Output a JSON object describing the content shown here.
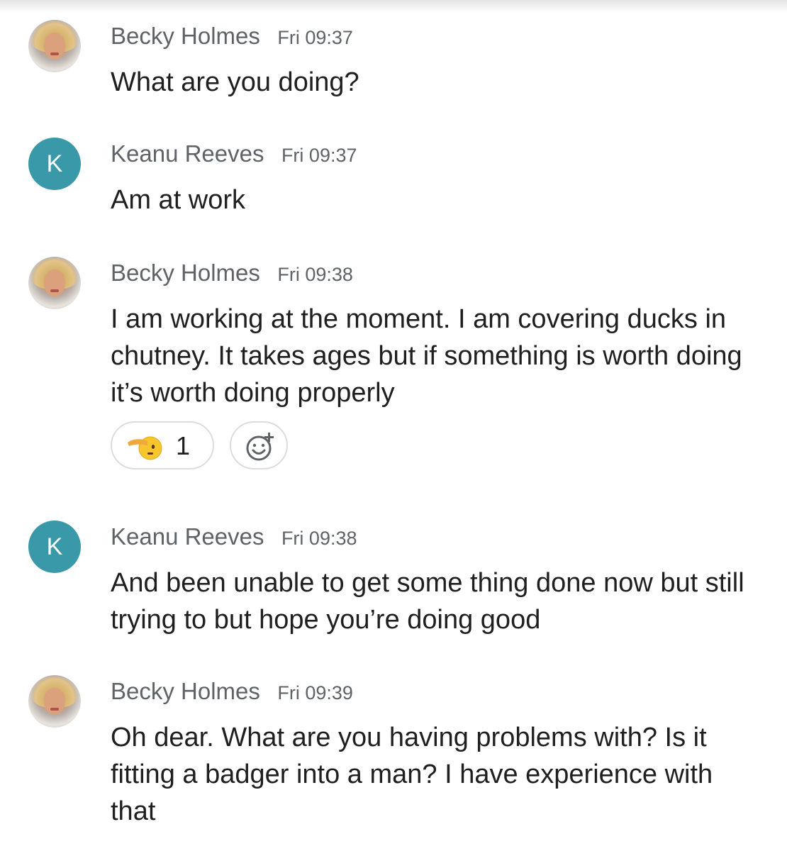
{
  "messages": [
    {
      "sender": "Becky Holmes",
      "time": "Fri 09:37",
      "avatar": "photo",
      "text": "What are you doing?"
    },
    {
      "sender": "Keanu Reeves",
      "time": "Fri 09:37",
      "avatar": "letter",
      "avatar_letter": "K",
      "avatar_color": "#3a99a8",
      "text": "Am at work"
    },
    {
      "sender": "Becky Holmes",
      "time": "Fri 09:38",
      "avatar": "photo",
      "text": "I am working at the moment. I am covering ducks in chutney. It takes ages but if something is worth doing it’s worth doing properly",
      "reactions": [
        {
          "emoji_icon": "saluting-face-icon",
          "count": "1"
        }
      ],
      "add_reaction_icon": "add-emoji-icon"
    },
    {
      "sender": "Keanu Reeves",
      "time": "Fri 09:38",
      "avatar": "letter",
      "avatar_letter": "K",
      "avatar_color": "#3a99a8",
      "text": "And been unable to get some thing done now but still trying to but hope you’re doing good"
    },
    {
      "sender": "Becky Holmes",
      "time": "Fri 09:39",
      "avatar": "photo",
      "text": "Oh dear. What are you having problems with? Is it fitting a badger into a man? I have experience with that"
    }
  ]
}
